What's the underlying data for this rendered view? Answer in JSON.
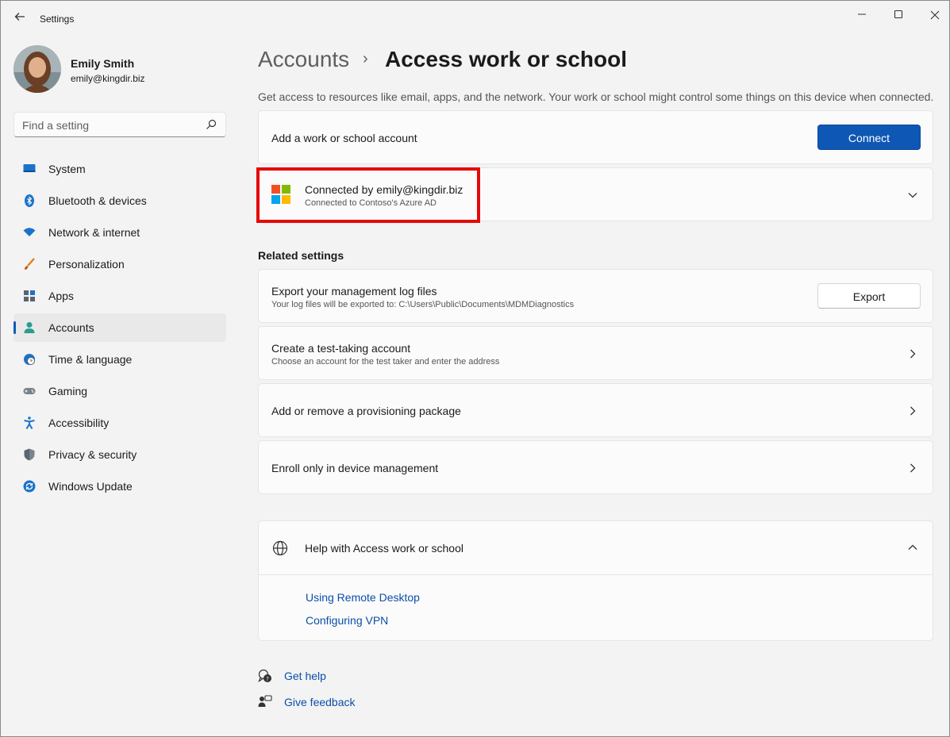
{
  "window": {
    "title": "Settings"
  },
  "user": {
    "name": "Emily Smith",
    "email": "emily@kingdir.biz"
  },
  "search": {
    "placeholder": "Find a setting"
  },
  "nav": [
    {
      "label": "System",
      "icon": "system-icon"
    },
    {
      "label": "Bluetooth & devices",
      "icon": "bluetooth-icon"
    },
    {
      "label": "Network & internet",
      "icon": "wifi-icon"
    },
    {
      "label": "Personalization",
      "icon": "brush-icon"
    },
    {
      "label": "Apps",
      "icon": "apps-icon"
    },
    {
      "label": "Accounts",
      "icon": "person-icon",
      "active": true
    },
    {
      "label": "Time & language",
      "icon": "clock-globe-icon"
    },
    {
      "label": "Gaming",
      "icon": "gamepad-icon"
    },
    {
      "label": "Accessibility",
      "icon": "accessibility-icon"
    },
    {
      "label": "Privacy & security",
      "icon": "shield-icon"
    },
    {
      "label": "Windows Update",
      "icon": "update-icon"
    }
  ],
  "breadcrumb": {
    "parent": "Accounts",
    "separator": "›",
    "current": "Access work or school"
  },
  "description": "Get access to resources like email, apps, and the network. Your work or school might control some things on this device when connected.",
  "add_account": {
    "title": "Add a work or school account",
    "button": "Connect"
  },
  "connected": {
    "title": "Connected by emily@kingdir.biz",
    "subtitle": "Connected to Contoso's Azure AD"
  },
  "related": {
    "title": "Related settings",
    "export": {
      "title": "Export your management log files",
      "subtitle": "Your log files will be exported to: C:\\Users\\Public\\Documents\\MDMDiagnostics",
      "button": "Export"
    },
    "test_account": {
      "title": "Create a test-taking account",
      "subtitle": "Choose an account for the test taker and enter the address"
    },
    "provisioning": {
      "title": "Add or remove a provisioning package"
    },
    "enroll": {
      "title": "Enroll only in device management"
    }
  },
  "help": {
    "title": "Help with Access work or school",
    "links": [
      "Using Remote Desktop",
      "Configuring VPN"
    ]
  },
  "footer": {
    "get_help": "Get help",
    "give_feedback": "Give feedback"
  },
  "colors": {
    "accent": "#0f57b4",
    "highlight": "#e50a0a",
    "link": "#0b4fa8"
  }
}
